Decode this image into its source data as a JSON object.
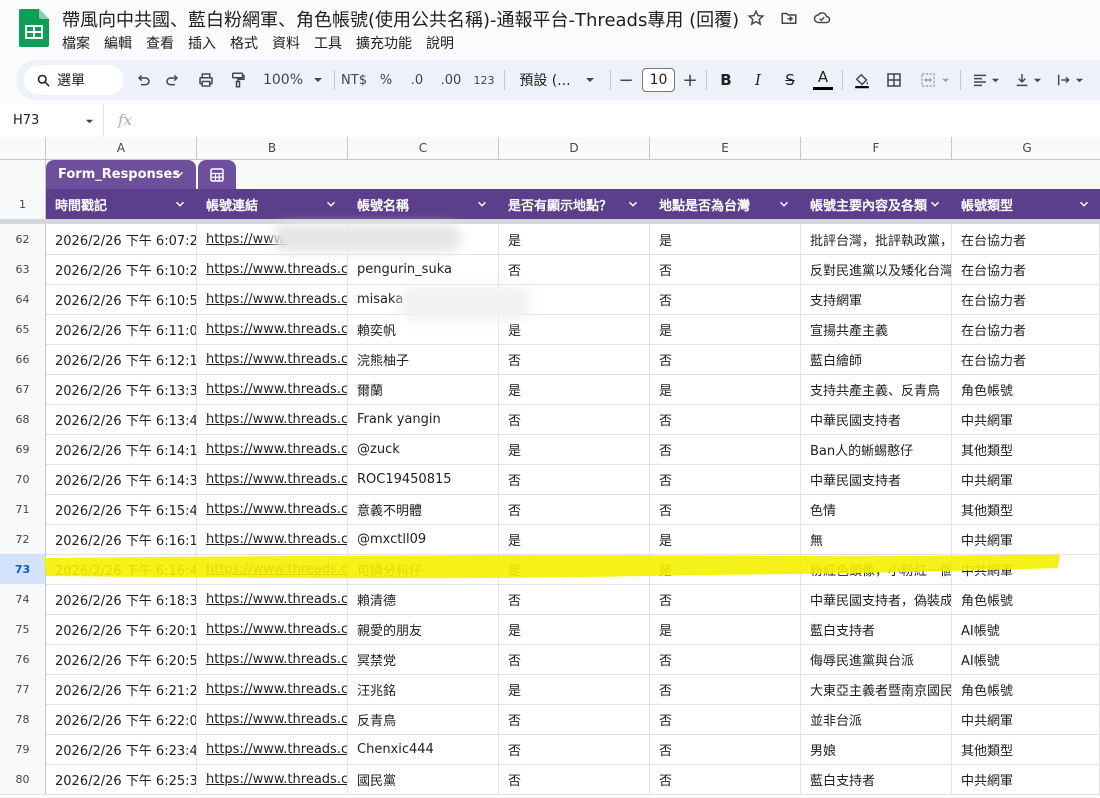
{
  "app": {
    "doc_title": "帶風向中共國、藍白粉網軍、角色帳號(使用公共名稱)-通報平台-Threads專用 (回覆)",
    "menu": [
      "檔案",
      "編輯",
      "查看",
      "插入",
      "格式",
      "資料",
      "工具",
      "擴充功能",
      "說明"
    ]
  },
  "toolbar": {
    "search_menu": "選單",
    "zoom": "100%",
    "currency": "NT$",
    "percent": "%",
    "dec_decrease": ".0",
    "dec_increase": ".00",
    "number_format": "123",
    "font_name": "預設 (...",
    "font_size": "10",
    "minus": "−",
    "plus": "+",
    "bold": "B",
    "italic": "I",
    "strike": "S",
    "text_color": "A"
  },
  "formula_bar": {
    "cell_ref": "H73",
    "fx": "fx"
  },
  "grid": {
    "column_letters": [
      "A",
      "B",
      "C",
      "D",
      "E",
      "F",
      "G"
    ],
    "table_name": "Form_Responses",
    "header_row_number": "1",
    "headers": [
      "時間戳記",
      "帳號連結",
      "帳號名稱",
      "是否有顯示地點？",
      "地點是否為台灣",
      "帳號主要內容及各類",
      "帳號類型"
    ],
    "selected_row": "73",
    "rows": [
      {
        "n": "62",
        "a": "2026/2/26 下午 6:07:27",
        "b": "https://www.",
        "c": "",
        "d": "是",
        "e": "是",
        "f": "批評台灣，批評執政黨，",
        "g": "在台協力者"
      },
      {
        "n": "63",
        "a": "2026/2/26 下午 6:10:24",
        "b": "https://www.threads.com",
        "c": "pengurin_suka",
        "d": "否",
        "e": "否",
        "f": "反對民進黨以及矮化台灣",
        "g": "在台協力者"
      },
      {
        "n": "64",
        "a": "2026/2/26 下午 6:10:52",
        "b": "https://www.threads.com",
        "c": "misaka",
        "d": "",
        "e": "否",
        "f": "支持網軍",
        "g": "在台協力者"
      },
      {
        "n": "65",
        "a": "2026/2/26 下午 6:11:05",
        "b": "https://www.threads.com",
        "c": "賴奕帆",
        "d": "是",
        "e": "是",
        "f": "宣揚共產主義",
        "g": "在台協力者"
      },
      {
        "n": "66",
        "a": "2026/2/26 下午 6:12:11",
        "b": "https://www.threads.com",
        "c": "浣熊柚子",
        "d": "否",
        "e": "否",
        "f": "藍白繪師",
        "g": "在台協力者"
      },
      {
        "n": "67",
        "a": "2026/2/26 下午 6:13:30",
        "b": "https://www.threads.com",
        "c": "爾蘭",
        "d": "是",
        "e": "是",
        "f": "支持共產主義、反青鳥",
        "g": "角色帳號"
      },
      {
        "n": "68",
        "a": "2026/2/26 下午 6:13:43",
        "b": "https://www.threads.com",
        "c": "Frank yangin",
        "d": "否",
        "e": "否",
        "f": "中華民國支持者",
        "g": "中共網軍"
      },
      {
        "n": "69",
        "a": "2026/2/26 下午 6:14:17",
        "b": "https://www.threads.com",
        "c": "@zuck",
        "d": "是",
        "e": "否",
        "f": "Ban人的蜥蜴憨仔",
        "g": "其他類型"
      },
      {
        "n": "70",
        "a": "2026/2/26 下午 6:14:33",
        "b": "https://www.threads.com",
        "c": "ROC19450815",
        "d": "否",
        "e": "否",
        "f": "中華民國支持者",
        "g": "中共網軍"
      },
      {
        "n": "71",
        "a": "2026/2/26 下午 6:15:47",
        "b": "https://www.threads.com",
        "c": "意義不明體",
        "d": "否",
        "e": "否",
        "f": "色情",
        "g": "其他類型"
      },
      {
        "n": "72",
        "a": "2026/2/26 下午 6:16:17",
        "b": "https://www.threads.com",
        "c": "@mxctll09",
        "d": "是",
        "e": "是",
        "f": "無",
        "g": "中共網軍"
      },
      {
        "n": "73",
        "a": "2026/2/26 下午 6:16:45",
        "b": "https://www.threads.com",
        "c": "可憐分科仔",
        "d": "是",
        "e": "是",
        "f": "粉紅色頭像，小粉紅一個",
        "g": "中共網軍"
      },
      {
        "n": "74",
        "a": "2026/2/26 下午 6:18:31",
        "b": "https://www.threads.com",
        "c": "賴清德",
        "d": "否",
        "e": "否",
        "f": "中華民國支持者，偽裝成",
        "g": "角色帳號"
      },
      {
        "n": "75",
        "a": "2026/2/26 下午 6:20:14",
        "b": "https://www.threads.com",
        "c": "親愛的朋友",
        "d": "是",
        "e": "是",
        "f": "藍白支持者",
        "g": "AI帳號"
      },
      {
        "n": "76",
        "a": "2026/2/26 下午 6:20:53",
        "b": "https://www.threads.com",
        "c": "冥禁党",
        "d": "否",
        "e": "否",
        "f": "侮辱民進黨與台派",
        "g": "AI帳號"
      },
      {
        "n": "77",
        "a": "2026/2/26 下午 6:21:29",
        "b": "https://www.threads.com",
        "c": "汪兆銘",
        "d": "是",
        "e": "否",
        "f": "大東亞主義者暨南京國民",
        "g": "角色帳號"
      },
      {
        "n": "78",
        "a": "2026/2/26 下午 6:22:09",
        "b": "https://www.threads.com",
        "c": "反青鳥",
        "d": "否",
        "e": "否",
        "f": "並非台派",
        "g": "中共網軍"
      },
      {
        "n": "79",
        "a": "2026/2/26 下午 6:23:47",
        "b": "https://www.threads.com",
        "c": "Chenxic444",
        "d": "否",
        "e": "否",
        "f": "男娘",
        "g": "其他類型"
      },
      {
        "n": "80",
        "a": "2026/2/26 下午 6:25:31",
        "b": "https://www.threads.com",
        "c": "國民黨",
        "d": "否",
        "e": "否",
        "f": "藍白支持者",
        "g": "中共網軍"
      }
    ]
  },
  "colors": {
    "header_bg": "#5b3f8c",
    "tab_bg": "#6e4f9e",
    "highlight": "#f5f000",
    "sheets_green": "#0f9d58"
  }
}
